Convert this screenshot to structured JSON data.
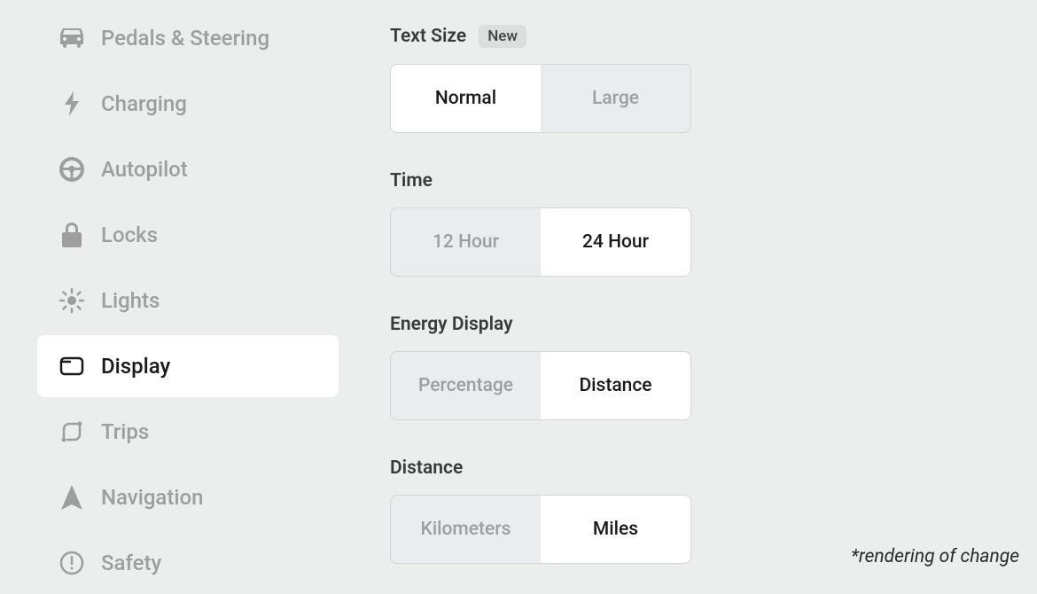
{
  "sidebar": {
    "items": [
      {
        "label": "Pedals & Steering",
        "active": false
      },
      {
        "label": "Charging",
        "active": false
      },
      {
        "label": "Autopilot",
        "active": false
      },
      {
        "label": "Locks",
        "active": false
      },
      {
        "label": "Lights",
        "active": false
      },
      {
        "label": "Display",
        "active": true
      },
      {
        "label": "Trips",
        "active": false
      },
      {
        "label": "Navigation",
        "active": false
      },
      {
        "label": "Safety",
        "active": false
      }
    ]
  },
  "settings": {
    "textSize": {
      "title": "Text Size",
      "badge": "New",
      "options": [
        "Normal",
        "Large"
      ],
      "selected": "Normal"
    },
    "time": {
      "title": "Time",
      "options": [
        "12 Hour",
        "24 Hour"
      ],
      "selected": "24 Hour"
    },
    "energyDisplay": {
      "title": "Energy Display",
      "options": [
        "Percentage",
        "Distance"
      ],
      "selected": "Distance"
    },
    "distance": {
      "title": "Distance",
      "options": [
        "Kilometers",
        "Miles"
      ],
      "selected": "Miles"
    }
  },
  "footnote": "*rendering of change"
}
